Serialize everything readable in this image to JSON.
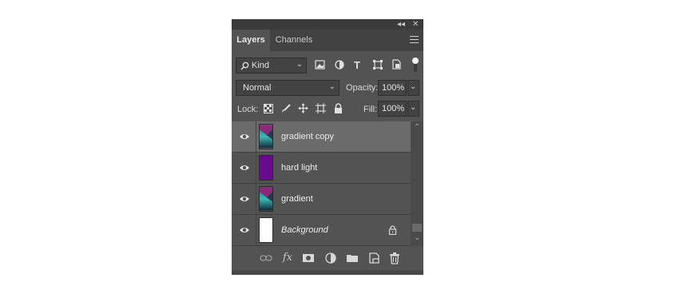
{
  "panel": {
    "tabs": [
      {
        "label": "Layers",
        "active": true
      },
      {
        "label": "Channels",
        "active": false
      }
    ],
    "filter": {
      "kind_label": "Kind",
      "icons": [
        "image-filter-icon",
        "adjustment-filter-icon",
        "type-filter-icon",
        "shape-filter-icon",
        "smart-object-filter-icon",
        "filter-toggle-icon"
      ]
    },
    "blend": {
      "mode": "Normal",
      "opacity_label": "Opacity:",
      "opacity_value": "100%"
    },
    "lock": {
      "label": "Lock:",
      "icons": [
        "lock-transparent-icon",
        "lock-image-icon",
        "lock-position-icon",
        "lock-artboard-icon",
        "lock-all-icon"
      ],
      "fill_label": "Fill:",
      "fill_value": "100%"
    },
    "layers": [
      {
        "name": "gradient copy",
        "thumb": "gradient",
        "selected": true,
        "visible": true,
        "italic": false,
        "locked": false
      },
      {
        "name": "hard light",
        "thumb": "purple",
        "selected": false,
        "visible": true,
        "italic": false,
        "locked": false
      },
      {
        "name": "gradient",
        "thumb": "gradient",
        "selected": false,
        "visible": true,
        "italic": false,
        "locked": false
      },
      {
        "name": "Background",
        "thumb": "white",
        "selected": false,
        "visible": true,
        "italic": true,
        "locked": true
      }
    ],
    "bottom_icons": [
      "link-layers-icon",
      "fx-icon",
      "mask-icon",
      "adjustment-layer-icon",
      "new-group-icon",
      "new-layer-icon",
      "delete-layer-icon"
    ],
    "fx_label": "fx"
  },
  "colors": {
    "panel_bg": "#535353",
    "selected_row": "#6b6b6b",
    "purple": "#6a0a8e",
    "teal": "#2aa6a6"
  }
}
